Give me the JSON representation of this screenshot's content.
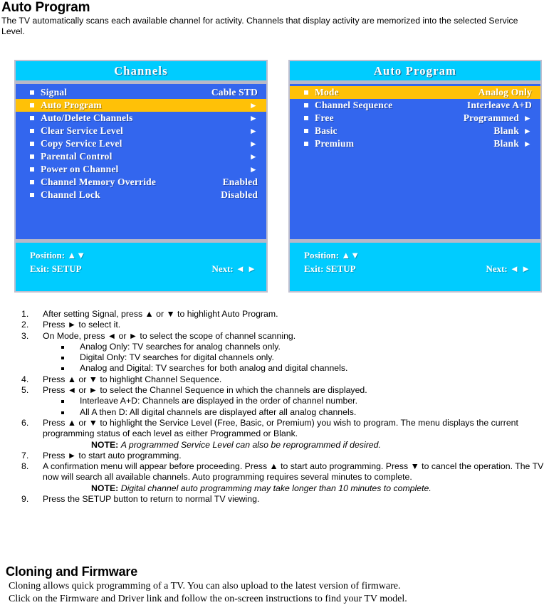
{
  "page": {
    "title": "Auto Program",
    "intro": "The TV automatically scans each available channel for activity. Channels that display activity are memorized into the selected Service Level."
  },
  "colors": {
    "osd_header_bg": "#00ccff",
    "osd_body_bg": "#3366ee",
    "osd_highlight_bg": "#ffc107",
    "osd_border": "#bfbfd0",
    "osd_separator": "#b8b8c8",
    "osd_text": "#ffffff"
  },
  "osd_left": {
    "header": "Channels",
    "rows": [
      {
        "label": "Signal",
        "value": "Cable STD",
        "arrow": "",
        "highlight": false
      },
      {
        "label": "Auto Program",
        "value": "",
        "arrow": "►",
        "highlight": true
      },
      {
        "label": "Auto/Delete Channels",
        "value": "",
        "arrow": "►",
        "highlight": false
      },
      {
        "label": "Clear Service Level",
        "value": "",
        "arrow": "►",
        "highlight": false
      },
      {
        "label": "Copy Service Level",
        "value": "",
        "arrow": "►",
        "highlight": false
      },
      {
        "label": "Parental Control",
        "value": "",
        "arrow": "►",
        "highlight": false
      },
      {
        "label": "Power on Channel",
        "value": "",
        "arrow": "►",
        "highlight": false
      },
      {
        "label": "Channel Memory Override",
        "value": "Enabled",
        "arrow": "",
        "highlight": false
      },
      {
        "label": "Channel Lock",
        "value": "Disabled",
        "arrow": "",
        "highlight": false
      }
    ],
    "footer": {
      "position_label": "Position: ▲▼",
      "exit_label": "Exit: SETUP",
      "next_label": "Next: ◄ ►"
    }
  },
  "osd_right": {
    "header": "Auto Program",
    "rows": [
      {
        "label": "Mode",
        "value": "Analog Only",
        "arrow": "",
        "highlight": true
      },
      {
        "label": "Channel Sequence",
        "value": "Interleave A+D",
        "arrow": "",
        "highlight": false
      },
      {
        "label": "Free",
        "value": "Programmed",
        "arrow": "►",
        "highlight": false
      },
      {
        "label": "Basic",
        "value": "Blank",
        "arrow": "►",
        "highlight": false
      },
      {
        "label": "Premium",
        "value": "Blank",
        "arrow": "►",
        "highlight": false
      }
    ],
    "footer": {
      "position_label": "Position: ▲▼",
      "exit_label": "Exit: SETUP",
      "next_label": "Next: ◄ ►"
    }
  },
  "steps": [
    {
      "num": "1.",
      "text": "After setting Signal, press ▲ or ▼ to highlight Auto Program."
    },
    {
      "num": "2.",
      "text": "Press ► to select it."
    },
    {
      "num": "3.",
      "text": "On Mode, press ◄ or ► to select the scope of channel scanning.",
      "sub": [
        "Analog Only: TV searches for analog channels only.",
        "Digital Only: TV searches for digital channels only.",
        "Analog and Digital: TV searches for both analog and digital channels."
      ]
    },
    {
      "num": "4.",
      "text": "Press ▲ or ▼ to highlight Channel Sequence."
    },
    {
      "num": "5.",
      "text": "Press ◄ or ► to select the Channel Sequence in which the channels are displayed.",
      "sub": [
        "Interleave A+D: Channels are displayed in the order of channel number.",
        "All A then D: All digital channels are displayed after all analog channels."
      ]
    },
    {
      "num": "6.",
      "text": "Press ▲ or ▼ to highlight the Service Level (Free, Basic, or Premium) you wish to program. The menu displays the current programming status of each level as either Programmed or Blank.",
      "note_label": "NOTE:",
      "note_body": "A programmed Service Level can also be reprogrammed if desired."
    },
    {
      "num": "7.",
      "text": "Press ► to start auto programming."
    },
    {
      "num": "8.",
      "text": "A confirmation menu will appear before proceeding. Press ▲ to start auto programming. Press ▼ to cancel the operation. The TV now will search all available channels.  Auto programming requires several minutes to complete.",
      "note_label": "NOTE:",
      "note_body": "Digital channel auto programming may take longer than 10 minutes to complete."
    },
    {
      "num": "9.",
      "text": "Press the SETUP button to return to normal TV viewing."
    }
  ],
  "section2": {
    "title": "Cloning and Firmware",
    "line1": "Cloning allows quick programming of a TV. You can also upload to the latest version of firmware.",
    "line2": "Click on the Firmware and Driver link and follow the on-screen instructions to find your TV model."
  }
}
